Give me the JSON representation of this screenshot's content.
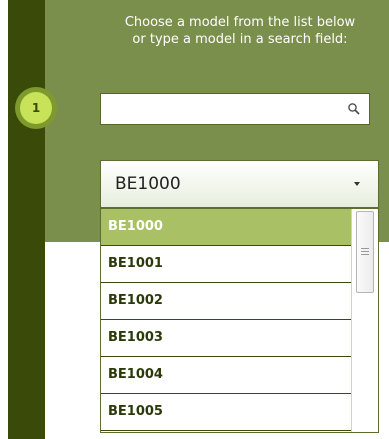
{
  "instructions": {
    "line1": "Choose a model from the list below",
    "line2": "or type a model in a search field:"
  },
  "step": {
    "number": "1"
  },
  "search": {
    "value": "",
    "placeholder": ""
  },
  "select": {
    "value": "BE1000"
  },
  "dropdown": {
    "items": [
      "BE1000",
      "BE1001",
      "BE1002",
      "BE1003",
      "BE1004",
      "BE1005"
    ],
    "selected_index": 0
  },
  "colors": {
    "dark_green": "#3a4a08",
    "panel_green": "#7b8f4c",
    "highlight": "#a9c164",
    "step_badge": "#c8e35a"
  }
}
